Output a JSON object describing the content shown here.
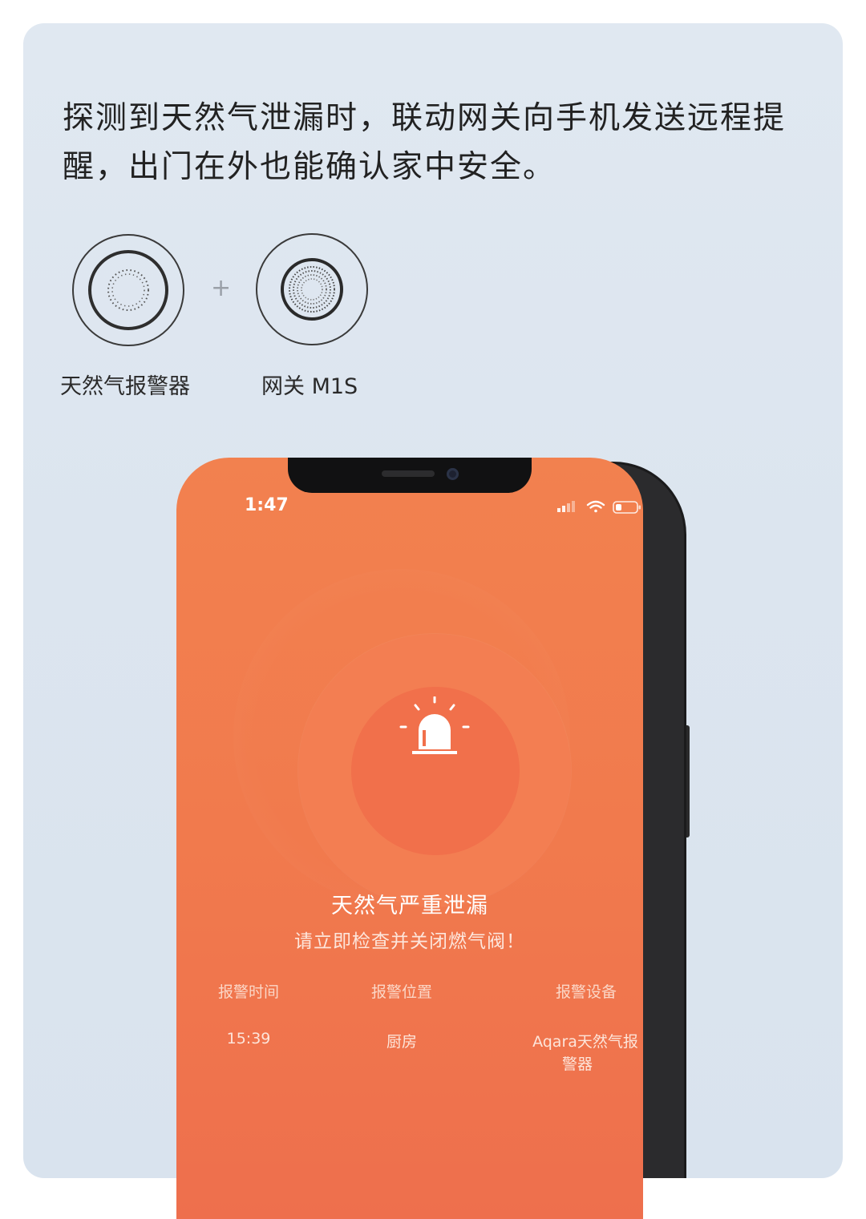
{
  "headline": "探测到天然气泄漏时，联动网关向手机发送远程提醒，出门在外也能确认家中安全。",
  "devices": [
    {
      "label": "天然气报警器",
      "icon": "gas-alarm-icon"
    },
    {
      "label": "网关 M1S",
      "icon": "gateway-icon"
    }
  ],
  "plus_sign": "+",
  "phone": {
    "status_bar": {
      "time": "1:47"
    },
    "alert": {
      "icon": "siren-icon",
      "title": "天然气严重泄漏",
      "subtitle": "请立即检查并关闭燃气阀！"
    },
    "info": {
      "time_label": "报警时间",
      "location_label": "报警位置",
      "device_label": "报警设备",
      "time_value": "15:39",
      "location_value": "厨房",
      "device_value_line1": "Aqara天然气报",
      "device_value_line2": "警器"
    }
  },
  "colors": {
    "background": "#dde6f0",
    "screen_orange": "#f17a4d"
  }
}
